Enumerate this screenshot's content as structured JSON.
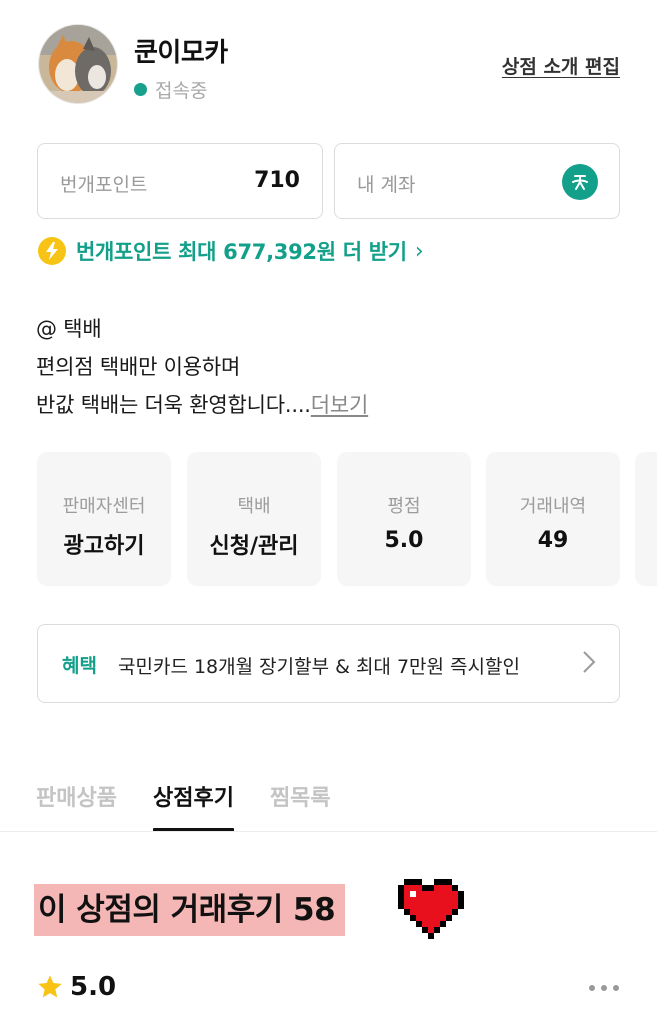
{
  "profile": {
    "shop_name": "쿤이모카",
    "status": "접속중",
    "edit_link": "상점 소개 편집"
  },
  "points": {
    "label": "번개포인트",
    "value": "710"
  },
  "account": {
    "label": "내 계좌",
    "icon": "bank-icon"
  },
  "promo": {
    "text": "번개포인트 최대 677,392원 더 받기",
    "chevron": "›"
  },
  "intro": {
    "line1": "@ 택배",
    "line2": "편의점 택배만 이용하며",
    "line3": "반값 택배는 더욱 환영합니다....",
    "more": "더보기"
  },
  "cards": [
    {
      "label": "판매자센터",
      "value": "광고하기"
    },
    {
      "label": "택배",
      "value": "신청/관리"
    },
    {
      "label": "평점",
      "value": "5.0"
    },
    {
      "label": "거래내역",
      "value": "49"
    }
  ],
  "benefit": {
    "tag": "혜택",
    "text": "국민카드 18개월 장기할부 & 최대 7만원 즉시할인"
  },
  "tabs": [
    {
      "label": "판매상품",
      "active": false
    },
    {
      "label": "상점후기",
      "active": true
    },
    {
      "label": "찜목록",
      "active": false
    }
  ],
  "reviews": {
    "title": "이 상점의 거래후기 58",
    "rating": "5.0"
  },
  "colors": {
    "accent": "#13a08a",
    "highlight": "#f4b7b5",
    "heart": "#e8101c"
  }
}
